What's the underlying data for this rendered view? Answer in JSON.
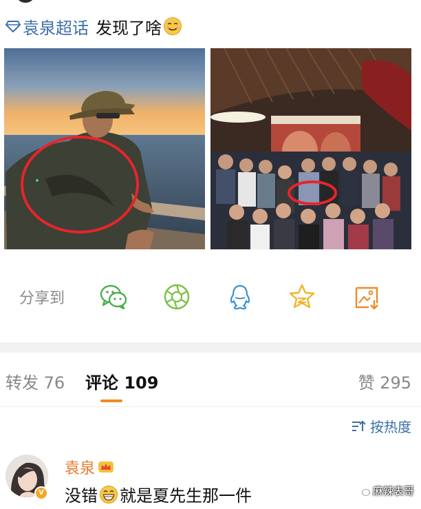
{
  "post": {
    "topic_label": "袁泉超话",
    "body_text": "发现了啥",
    "topic_icon": "diamond-icon",
    "emoji": "smirk-emoji"
  },
  "share": {
    "label": "分享到",
    "targets": [
      {
        "name": "wechat",
        "icon": "wechat-icon",
        "color": "#4cae4f"
      },
      {
        "name": "moments",
        "icon": "moments-icon",
        "color": "#79c043"
      },
      {
        "name": "qq",
        "icon": "qq-icon",
        "color": "#3b8fd6"
      },
      {
        "name": "favorites",
        "icon": "star-icon",
        "color": "#f0b429"
      },
      {
        "name": "save-image",
        "icon": "save-image-icon",
        "color": "#f08a24"
      }
    ]
  },
  "tabs": {
    "repost_label": "转发 76",
    "comment_label": "评论 109",
    "like_label": "赞 295",
    "active": "comment"
  },
  "sort": {
    "label": "按热度",
    "icon": "sort-icon"
  },
  "comments": [
    {
      "username": "袁泉",
      "verified_badge": "V",
      "text_before": "没错",
      "emoji": "grin-emoji",
      "text_after": "就是夏先生那一件"
    }
  ],
  "watermark": {
    "text": "麻辣表哥"
  },
  "colors": {
    "link_blue": "#3b6fa8",
    "accent_orange": "#f08a24",
    "username_orange": "#e8792b",
    "annotation_red": "#e8242b"
  }
}
